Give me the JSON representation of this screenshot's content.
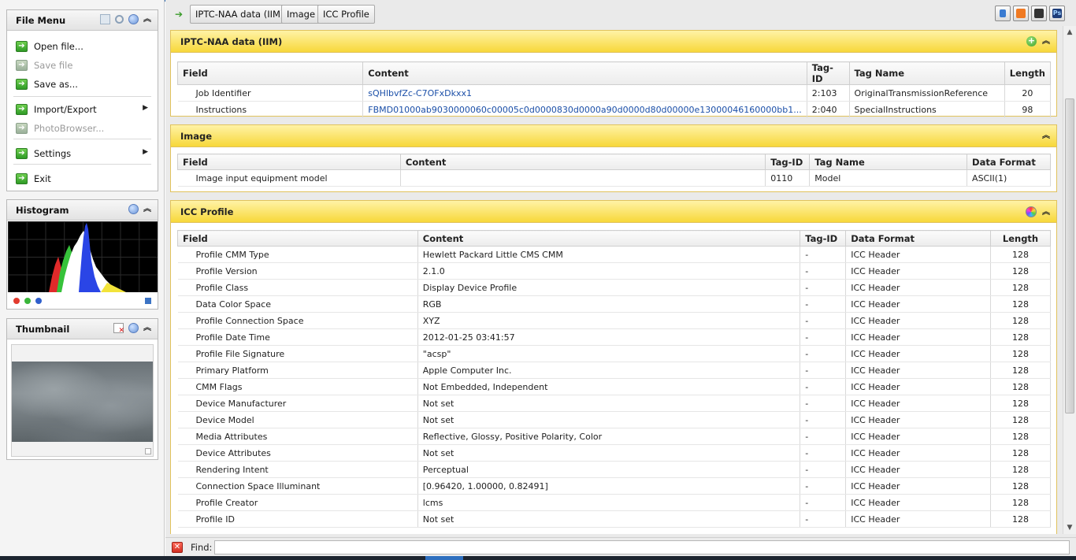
{
  "sidebar": {
    "file_menu": {
      "title": "File Menu",
      "items": [
        {
          "label": "Open file...",
          "enabled": true
        },
        {
          "label": "Save file",
          "enabled": false
        },
        {
          "label": "Save as...",
          "enabled": true
        },
        {
          "label": "Import/Export",
          "enabled": true,
          "submenu": true
        },
        {
          "label": "PhotoBrowser...",
          "enabled": false
        },
        {
          "label": "Settings",
          "enabled": true,
          "submenu": true
        },
        {
          "label": "Exit",
          "enabled": true
        }
      ]
    },
    "histogram": {
      "title": "Histogram",
      "channels": [
        "#e23b2e",
        "#3ab53a",
        "#2f5fcc"
      ]
    },
    "thumbnail": {
      "title": "Thumbnail"
    }
  },
  "toolbar": {
    "breadcrumbs": [
      "IPTC-NAA data (IIM)",
      "Image",
      "ICC Profile"
    ],
    "right_icons": [
      "home-icon",
      "camera-icon",
      "scanner-icon",
      "photoshop-icon"
    ]
  },
  "sections": {
    "iptc": {
      "title": "IPTC-NAA data (IIM)",
      "columns": [
        "Field",
        "Content",
        "Tag-ID",
        "Tag Name",
        "Length"
      ],
      "rows": [
        {
          "field": "Job Identifier",
          "content": "sQHlbvfZc-C7OFxDkxx1",
          "tag_id": "2:103",
          "tag_name": "OriginalTransmissionReference",
          "length": "20"
        },
        {
          "field": "Instructions",
          "content": "FBMD01000ab9030000060c00005c0d0000830d0000a90d0000d80d00000e13000046160000bb1...",
          "tag_id": "2:040",
          "tag_name": "SpecialInstructions",
          "length": "98"
        }
      ]
    },
    "image": {
      "title": "Image",
      "columns": [
        "Field",
        "Content",
        "Tag-ID",
        "Tag Name",
        "Data Format"
      ],
      "rows": [
        {
          "field": "Image input equipment model",
          "content": "",
          "tag_id": "0110",
          "tag_name": "Model",
          "format": "ASCII(1)"
        }
      ]
    },
    "icc": {
      "title": "ICC Profile",
      "columns": [
        "Field",
        "Content",
        "Tag-ID",
        "Data Format",
        "Length"
      ],
      "rows": [
        {
          "field": "Profile CMM Type",
          "content": "Hewlett Packard Little CMS CMM",
          "tag_id": "-",
          "format": "ICC Header",
          "length": "128"
        },
        {
          "field": "Profile Version",
          "content": "2.1.0",
          "tag_id": "-",
          "format": "ICC Header",
          "length": "128"
        },
        {
          "field": "Profile Class",
          "content": "Display Device Profile",
          "tag_id": "-",
          "format": "ICC Header",
          "length": "128"
        },
        {
          "field": "Data Color Space",
          "content": "RGB",
          "tag_id": "-",
          "format": "ICC Header",
          "length": "128"
        },
        {
          "field": "Profile Connection Space",
          "content": "XYZ",
          "tag_id": "-",
          "format": "ICC Header",
          "length": "128"
        },
        {
          "field": "Profile Date Time",
          "content": "2012-01-25 03:41:57",
          "tag_id": "-",
          "format": "ICC Header",
          "length": "128"
        },
        {
          "field": "Profile File Signature",
          "content": "\"acsp\"",
          "tag_id": "-",
          "format": "ICC Header",
          "length": "128"
        },
        {
          "field": "Primary Platform",
          "content": "Apple Computer Inc.",
          "tag_id": "-",
          "format": "ICC Header",
          "length": "128"
        },
        {
          "field": "CMM Flags",
          "content": "Not Embedded, Independent",
          "tag_id": "-",
          "format": "ICC Header",
          "length": "128"
        },
        {
          "field": "Device Manufacturer",
          "content": "Not set",
          "tag_id": "-",
          "format": "ICC Header",
          "length": "128"
        },
        {
          "field": "Device Model",
          "content": "Not set",
          "tag_id": "-",
          "format": "ICC Header",
          "length": "128"
        },
        {
          "field": "Media Attributes",
          "content": "Reflective, Glossy, Positive Polarity, Color",
          "tag_id": "-",
          "format": "ICC Header",
          "length": "128"
        },
        {
          "field": "Device Attributes",
          "content": "Not set",
          "tag_id": "-",
          "format": "ICC Header",
          "length": "128"
        },
        {
          "field": "Rendering Intent",
          "content": "Perceptual",
          "tag_id": "-",
          "format": "ICC Header",
          "length": "128"
        },
        {
          "field": "Connection Space Illuminant",
          "content": "[0.96420, 1.00000, 0.82491]",
          "tag_id": "-",
          "format": "ICC Header",
          "length": "128"
        },
        {
          "field": "Profile Creator",
          "content": "lcms",
          "tag_id": "-",
          "format": "ICC Header",
          "length": "128"
        },
        {
          "field": "Profile ID",
          "content": "Not set",
          "tag_id": "-",
          "format": "ICC Header",
          "length": "128"
        }
      ]
    }
  },
  "findbar": {
    "label": "Find:",
    "value": ""
  }
}
